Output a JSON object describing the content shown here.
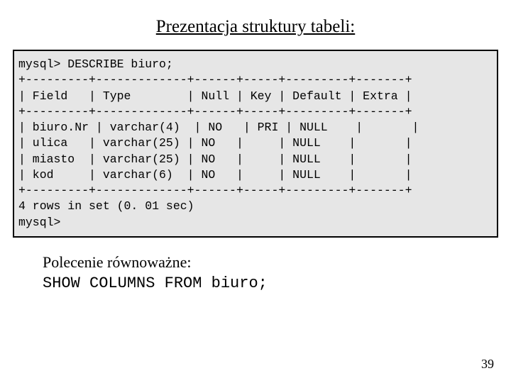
{
  "title": "Prezentacja struktury tabeli:",
  "code": {
    "l0": "mysql> DESCRIBE biuro;",
    "l1": "+---------+-------------+------+-----+---------+-------+",
    "l2": "| Field   | Type        | Null | Key | Default | Extra |",
    "l3": "+---------+-------------+------+-----+---------+-------+",
    "l4": "| biuro.Nr | varchar(4)  | NO   | PRI | NULL    |       |",
    "l5": "| ulica   | varchar(25) | NO   |     | NULL    |       |",
    "l6": "| miasto  | varchar(25) | NO   |     | NULL    |       |",
    "l7": "| kod     | varchar(6)  | NO   |     | NULL    |       |",
    "l8": "+---------+-------------+------+-----+---------+-------+",
    "l9": "4 rows in set (0. 01 sec)",
    "l10": "mysql>"
  },
  "below": {
    "line1": "Polecenie równoważne:",
    "line2": "SHOW COLUMNS FROM biuro;"
  },
  "page": "39"
}
